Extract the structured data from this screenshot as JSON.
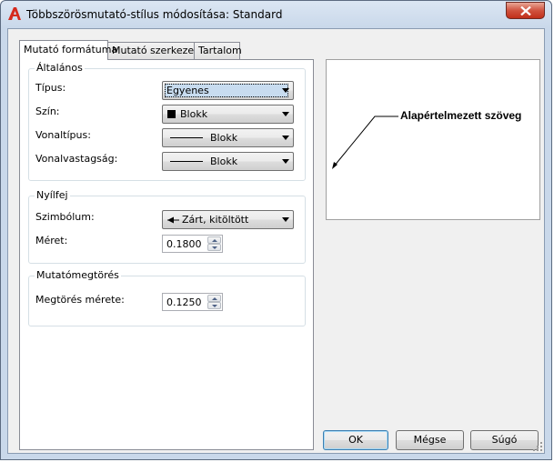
{
  "window": {
    "title": "Többszörösmutató-stílus módosítása: Standard"
  },
  "tabs": [
    {
      "label": "Mutató formátuma",
      "active": true
    },
    {
      "label": "Mutató szerkezete",
      "active": false
    },
    {
      "label": "Tartalom",
      "active": false
    }
  ],
  "general": {
    "legend": "Általános",
    "type_label": "Típus:",
    "type_value": "Egyenes",
    "color_label": "Szín:",
    "color_value": "Blokk",
    "linetype_label": "Vonaltípus:",
    "linetype_value": "Blokk",
    "lineweight_label": "Vonalvastagság:",
    "lineweight_value": "Blokk"
  },
  "arrowhead": {
    "legend": "Nyílfej",
    "symbol_label": "Szimbólum:",
    "symbol_value": "Zárt, kitöltött",
    "size_label": "Méret:",
    "size_value": "0.1800"
  },
  "landing": {
    "legend": "Mutatómegtörés",
    "break_label": "Megtörés mérete:",
    "break_value": "0.1250"
  },
  "preview": {
    "text": "Alapértelmezett szöveg"
  },
  "buttons": {
    "ok": "OK",
    "cancel": "Mégse",
    "help": "Súgó"
  },
  "colors": {
    "close_red": "#c12f1a",
    "app_icon_red": "#d52b1e"
  }
}
